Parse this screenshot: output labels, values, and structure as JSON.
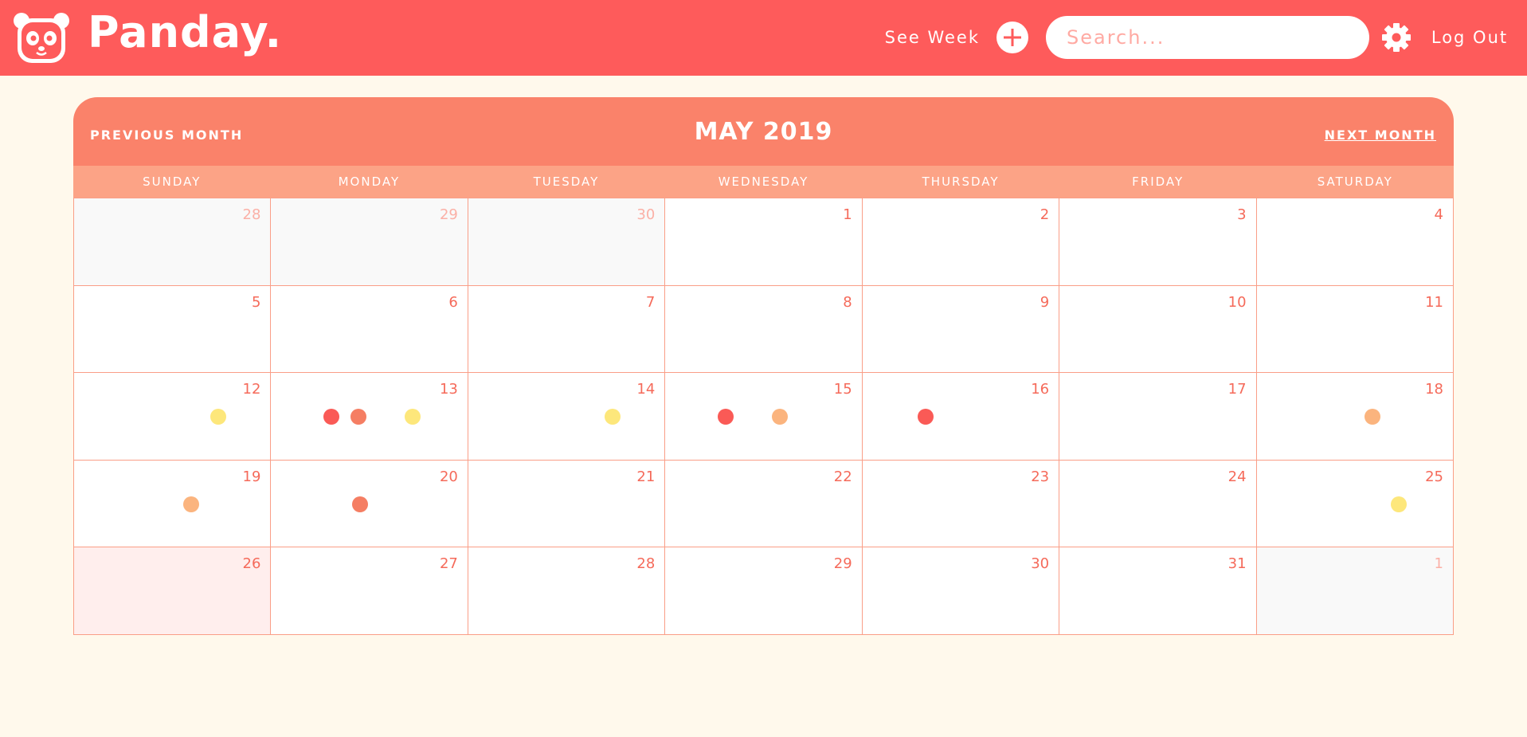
{
  "app": {
    "name": "Panday."
  },
  "header": {
    "see_week": "See Week",
    "add_icon": "plus-icon",
    "search_placeholder": "Search...",
    "settings_icon": "gear-icon",
    "logout": "Log Out"
  },
  "calendar": {
    "title": "MAY 2019",
    "prev_label": "PREVIOUS MONTH",
    "next_label": "NEXT MONTH",
    "weekdays": [
      "SUNDAY",
      "MONDAY",
      "TUESDAY",
      "WEDNESDAY",
      "THURSDAY",
      "FRIDAY",
      "SATURDAY"
    ],
    "cells": [
      {
        "day": "28",
        "muted": true,
        "dots": []
      },
      {
        "day": "29",
        "muted": true,
        "dots": []
      },
      {
        "day": "30",
        "muted": true,
        "dots": []
      },
      {
        "day": "1",
        "dots": []
      },
      {
        "day": "2",
        "dots": []
      },
      {
        "day": "3",
        "dots": []
      },
      {
        "day": "4",
        "dots": []
      },
      {
        "day": "5",
        "dots": []
      },
      {
        "day": "6",
        "dots": []
      },
      {
        "day": "7",
        "dots": []
      },
      {
        "day": "8",
        "dots": []
      },
      {
        "day": "9",
        "dots": []
      },
      {
        "day": "10",
        "dots": []
      },
      {
        "day": "11",
        "dots": []
      },
      {
        "day": "12",
        "dots": [
          "yellow"
        ]
      },
      {
        "day": "13",
        "dots": [
          "red",
          "coral",
          "yellow"
        ]
      },
      {
        "day": "14",
        "dots": [
          "yellow"
        ]
      },
      {
        "day": "15",
        "dots": [
          "red",
          "orange"
        ]
      },
      {
        "day": "16",
        "dots": [
          "red"
        ]
      },
      {
        "day": "17",
        "dots": []
      },
      {
        "day": "18",
        "dots": [
          "orange"
        ]
      },
      {
        "day": "19",
        "dots": [
          "orange"
        ]
      },
      {
        "day": "20",
        "dots": [
          "coral"
        ]
      },
      {
        "day": "21",
        "dots": []
      },
      {
        "day": "22",
        "dots": []
      },
      {
        "day": "23",
        "dots": []
      },
      {
        "day": "24",
        "dots": []
      },
      {
        "day": "25",
        "dots": [
          "yellow"
        ]
      },
      {
        "day": "26",
        "today": true,
        "dots": []
      },
      {
        "day": "27",
        "dots": []
      },
      {
        "day": "28",
        "dots": []
      },
      {
        "day": "29",
        "dots": []
      },
      {
        "day": "30",
        "dots": []
      },
      {
        "day": "31",
        "dots": []
      },
      {
        "day": "1",
        "muted": true,
        "dots": []
      }
    ]
  },
  "colors": {
    "brand": "#fe5b5b",
    "header": "#fa826a",
    "weekday_bar": "#fca386",
    "background": "#fff9ec",
    "red": "#fa5a56",
    "coral": "#f57e63",
    "orange": "#fbb47e",
    "yellow": "#fde77b"
  }
}
